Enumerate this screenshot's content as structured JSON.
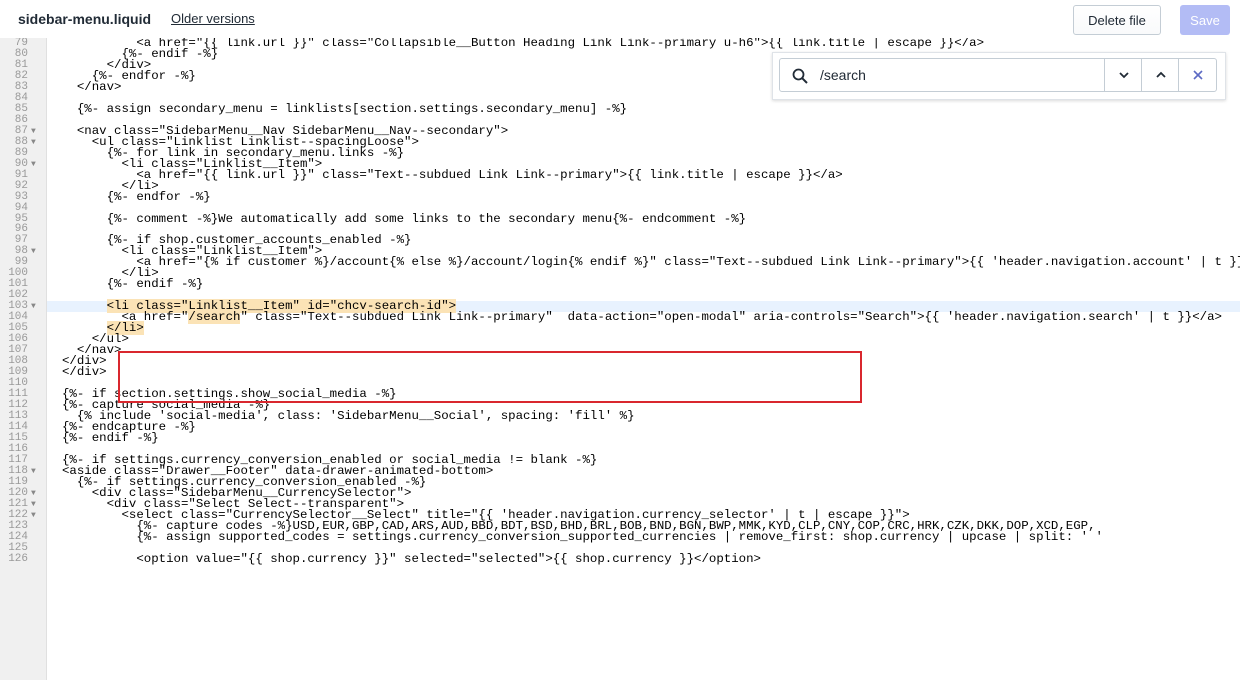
{
  "header": {
    "file_name": "sidebar-menu.liquid",
    "older_versions_label": "Older versions",
    "delete_label": "Delete file",
    "save_label": "Save"
  },
  "search": {
    "query": "/search"
  },
  "editor": {
    "lines": [
      {
        "n": "79",
        "t": "                  <a href=\"{{ link.url }}\" class=\"Collapsible__Button Heading Link Link--primary u-h6\">{{ link.title | escape }}</a>"
      },
      {
        "n": "80",
        "t": "                {%- endif -%}"
      },
      {
        "n": "81",
        "t": "              </div>"
      },
      {
        "n": "82",
        "t": "            {%- endfor -%}"
      },
      {
        "n": "83",
        "t": "          </nav>"
      },
      {
        "n": "84",
        "t": ""
      },
      {
        "n": "85",
        "t": "          {%- assign secondary_menu = linklists[section.settings.secondary_menu] -%}"
      },
      {
        "n": "86",
        "t": ""
      },
      {
        "n": "87",
        "f": true,
        "t": "          <nav class=\"SidebarMenu__Nav SidebarMenu__Nav--secondary\">"
      },
      {
        "n": "88",
        "f": true,
        "t": "            <ul class=\"Linklist Linklist--spacingLoose\">"
      },
      {
        "n": "89",
        "t": "              {%- for link in secondary_menu.links -%}"
      },
      {
        "n": "90",
        "f": true,
        "t": "                <li class=\"Linklist__Item\">"
      },
      {
        "n": "91",
        "t": "                  <a href=\"{{ link.url }}\" class=\"Text--subdued Link Link--primary\">{{ link.title | escape }}</a>"
      },
      {
        "n": "92",
        "t": "                </li>"
      },
      {
        "n": "93",
        "t": "              {%- endfor -%}"
      },
      {
        "n": "94",
        "t": ""
      },
      {
        "n": "95",
        "t": "              {%- comment -%}We automatically add some links to the secondary menu{%- endcomment -%}"
      },
      {
        "n": "96",
        "t": ""
      },
      {
        "n": "97",
        "t": "              {%- if shop.customer_accounts_enabled -%}"
      },
      {
        "n": "98",
        "f": true,
        "t": "                <li class=\"Linklist__Item\">"
      },
      {
        "n": "99",
        "t": "                  <a href=\"{% if customer %}/account{% else %}/account/login{% endif %}\" class=\"Text--subdued Link Link--primary\">{{ 'header.navigation.account' | t }}</a>"
      },
      {
        "n": "100",
        "t": "                </li>"
      },
      {
        "n": "101",
        "t": "              {%- endif -%}"
      },
      {
        "n": "102",
        "t": ""
      },
      {
        "n": "103",
        "f": true,
        "h": true,
        "t": "              <li class=\"Linklist__Item\" id=\"chcv-search-id\">"
      },
      {
        "n": "104",
        "h": true,
        "t": "                <a href=\"/search\" class=\"Text--subdued Link Link--primary\"  data-action=\"open-modal\" aria-controls=\"Search\">{{ 'header.navigation.search' | t }}</a>"
      },
      {
        "n": "105",
        "h": true,
        "t": "              </li>"
      },
      {
        "n": "106",
        "t": "            </ul>"
      },
      {
        "n": "107",
        "t": "          </nav>"
      },
      {
        "n": "108",
        "t": "        </div>"
      },
      {
        "n": "109",
        "t": "      </div>"
      },
      {
        "n": "110",
        "t": ""
      },
      {
        "n": "111",
        "t": "      {%- if section.settings.show_social_media -%}"
      },
      {
        "n": "112",
        "t": "        {%- capture social_media -%}"
      },
      {
        "n": "113",
        "t": "          {% include 'social-media', class: 'SidebarMenu__Social', spacing: 'fill' %}"
      },
      {
        "n": "114",
        "t": "        {%- endcapture -%}"
      },
      {
        "n": "115",
        "t": "      {%- endif -%}"
      },
      {
        "n": "116",
        "t": ""
      },
      {
        "n": "117",
        "t": "      {%- if settings.currency_conversion_enabled or social_media != blank -%}"
      },
      {
        "n": "118",
        "f": true,
        "t": "        <aside class=\"Drawer__Footer\" data-drawer-animated-bottom>"
      },
      {
        "n": "119",
        "t": "          {%- if settings.currency_conversion_enabled -%}"
      },
      {
        "n": "120",
        "f": true,
        "t": "            <div class=\"SidebarMenu__CurrencySelector\">"
      },
      {
        "n": "121",
        "f": true,
        "t": "              <div class=\"Select Select--transparent\">"
      },
      {
        "n": "122",
        "f": true,
        "t": "                <select class=\"CurrencySelector__Select\" title=\"{{ 'header.navigation.currency_selector' | t | escape }}\">"
      },
      {
        "n": "123",
        "t": "                  {%- capture codes -%}USD,EUR,GBP,CAD,ARS,AUD,BBD,BDT,BSD,BHD,BRL,BOB,BND,BGN,BWP,MMK,KYD,CLP,CNY,COP,CRC,HRK,CZK,DKK,DOP,XCD,EGP,"
      },
      {
        "n": "124",
        "t": "                  {%- assign supported_codes = settings.currency_conversion_supported_currencies | remove_first: shop.currency | upcase | split: ' '"
      },
      {
        "n": "125",
        "t": ""
      },
      {
        "n": "126",
        "t": "                  <option value=\"{{ shop.currency }}\" selected=\"selected\">{{ shop.currency }}</option>"
      }
    ]
  }
}
